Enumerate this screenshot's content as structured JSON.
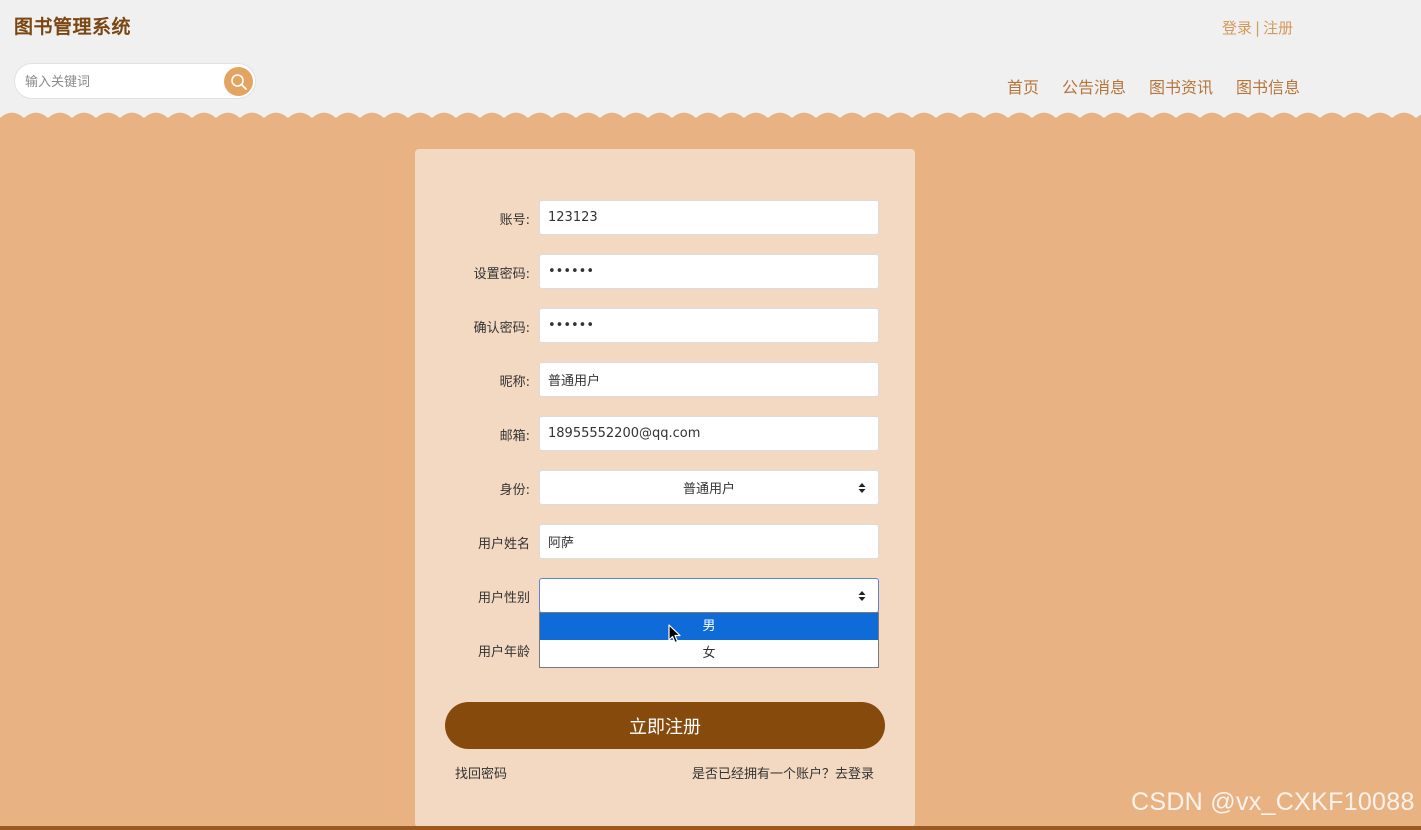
{
  "header": {
    "title": "图书管理系统",
    "auth": {
      "login": "登录",
      "separator": "|",
      "register": "注册"
    },
    "search": {
      "placeholder": "输入关键词",
      "icon": "search-icon"
    },
    "nav": [
      {
        "label": "首页"
      },
      {
        "label": "公告消息"
      },
      {
        "label": "图书资讯"
      },
      {
        "label": "图书信息"
      }
    ]
  },
  "form": {
    "account": {
      "label": "账号:",
      "value": "123123"
    },
    "password": {
      "label": "设置密码:",
      "value": "123123"
    },
    "confirm_password": {
      "label": "确认密码:",
      "value": "123123"
    },
    "nickname": {
      "label": "昵称:",
      "value": "普通用户"
    },
    "email": {
      "label": "邮箱:",
      "value": "18955552200@qq.com"
    },
    "identity": {
      "label": "身份:",
      "value": "普通用户"
    },
    "real_name": {
      "label": "用户姓名",
      "value": "阿萨"
    },
    "gender": {
      "label": "用户性别",
      "value": "",
      "options": [
        "男",
        "女"
      ],
      "highlighted": "男"
    },
    "age": {
      "label": "用户年龄",
      "value": ""
    },
    "submit_label": "立即注册",
    "forgot_password": "找回密码",
    "go_login": "是否已经拥有一个账户？去登录"
  },
  "watermark": "CSDN @vx_CXKF10088",
  "colors": {
    "page_bg": "#e9b283",
    "header_bg": "#f0f0f0",
    "card_bg": "#f3d8c2",
    "brand_brown": "#864a0d",
    "title_brown": "#7a4612",
    "nav_text": "#b6753a",
    "search_button": "#e4a461",
    "dropdown_highlight": "#0f6bd8"
  }
}
